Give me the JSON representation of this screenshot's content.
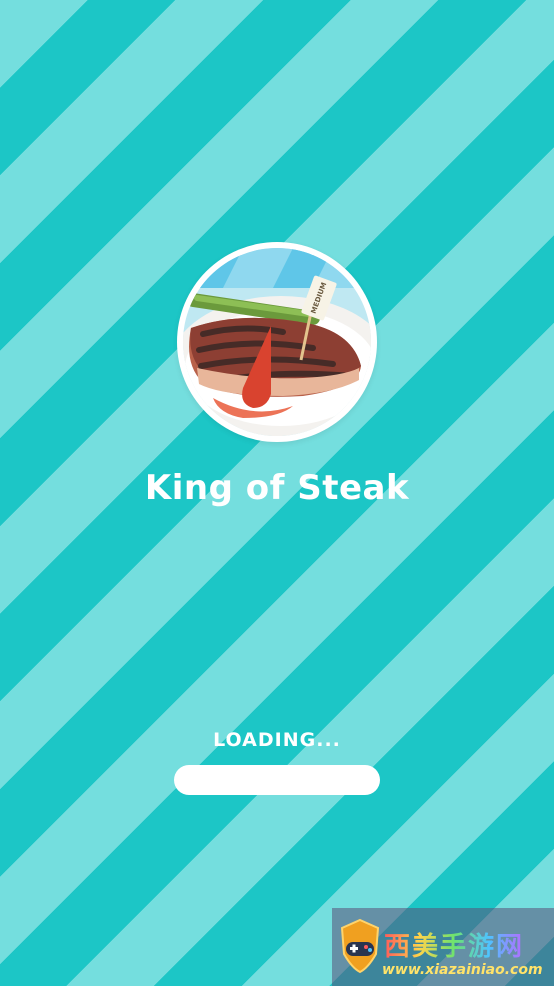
{
  "game": {
    "title": "King of Steak",
    "logo_sign": "MEDIUM"
  },
  "loading": {
    "label": "LOADING...",
    "progress": 0
  },
  "watermark": {
    "brand": "西美手游网",
    "url": "www.xiazainiao.com"
  },
  "colors": {
    "stripe_light": "#74dede",
    "stripe_dark": "#1cc6c6",
    "text": "#ffffff",
    "progress_track": "#ffffff"
  }
}
